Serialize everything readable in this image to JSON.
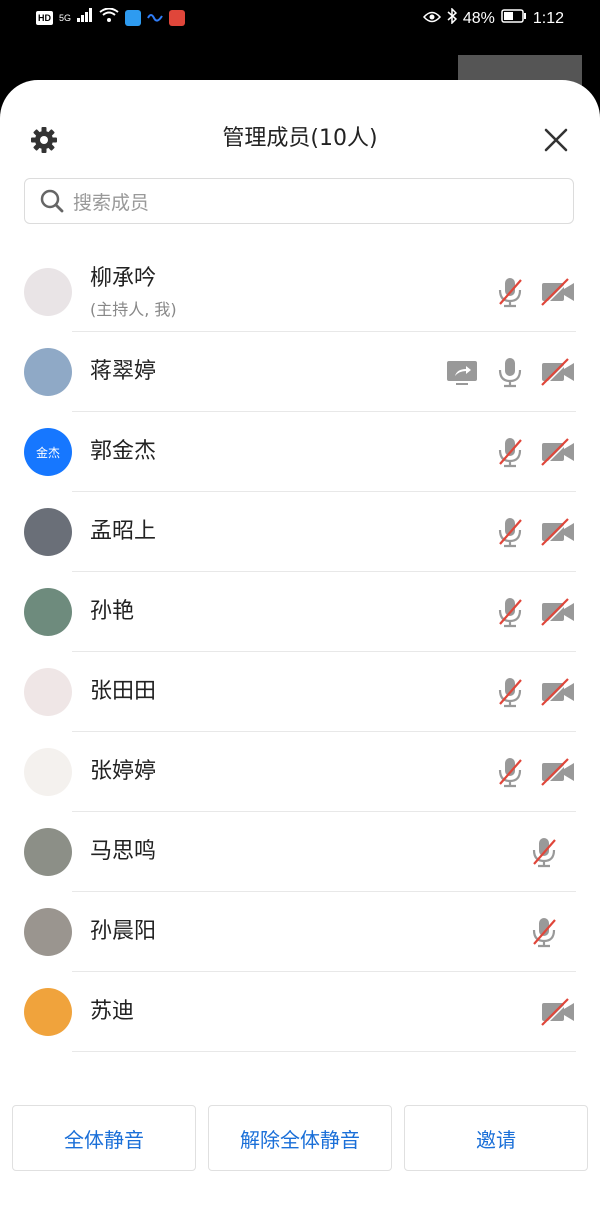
{
  "status_bar": {
    "left_badges": [
      "HD",
      "5G"
    ],
    "battery": "48%",
    "time": "1:12"
  },
  "header": {
    "title": "管理成员(10人)"
  },
  "search": {
    "placeholder": "搜索成员"
  },
  "members": [
    {
      "name": "柳承吟",
      "sub": "(主持人, 我)",
      "avatar_color": "#e9e4e6",
      "mic": "muted",
      "camera": "off",
      "screen_share": false
    },
    {
      "name": "蒋翠婷",
      "sub": "",
      "avatar_color": "#8fa9c6",
      "mic": "on",
      "camera": "off",
      "screen_share": true
    },
    {
      "name": "郭金杰",
      "sub": "",
      "avatar_color": "#1677ff",
      "avatar_text": "金杰",
      "mic": "muted",
      "camera": "off",
      "screen_share": false
    },
    {
      "name": "孟昭上",
      "sub": "",
      "avatar_color": "#6a6f78",
      "mic": "muted",
      "camera": "off",
      "screen_share": false
    },
    {
      "name": "孙艳",
      "sub": "",
      "avatar_color": "#6e8b7d",
      "mic": "muted",
      "camera": "off",
      "screen_share": false
    },
    {
      "name": "张田田",
      "sub": "",
      "avatar_color": "#efe6e6",
      "mic": "muted",
      "camera": "off",
      "screen_share": false
    },
    {
      "name": "张婷婷",
      "sub": "",
      "avatar_color": "#f4f1ee",
      "mic": "muted",
      "camera": "off",
      "screen_share": false
    },
    {
      "name": "马思鸣",
      "sub": "",
      "avatar_color": "#8c8f87",
      "mic": "muted",
      "camera": "none",
      "screen_share": false
    },
    {
      "name": "孙晨阳",
      "sub": "",
      "avatar_color": "#9a958f",
      "mic": "muted",
      "camera": "none",
      "screen_share": false
    },
    {
      "name": "苏迪",
      "sub": "",
      "avatar_color": "#f0a33c",
      "mic": "none",
      "camera": "off",
      "screen_share": false
    }
  ],
  "actions": {
    "mute_all": "全体静音",
    "unmute_all": "解除全体静音",
    "invite": "邀请"
  },
  "colors": {
    "accent": "#1a6fd8",
    "muted_red": "#e0463a",
    "icon_gray": "#999999"
  }
}
